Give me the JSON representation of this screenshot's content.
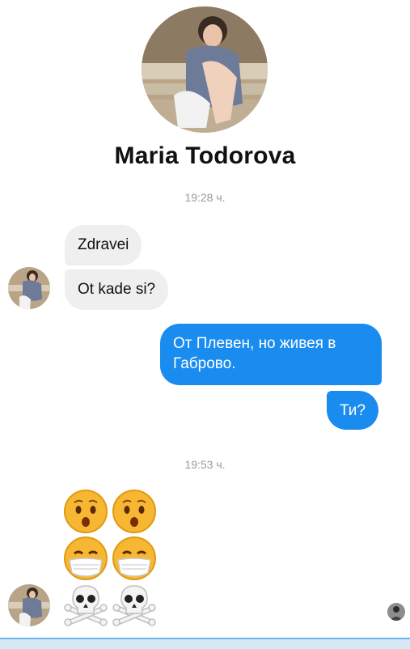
{
  "contact": {
    "name": "Maria Todorova"
  },
  "timestamps": [
    "19:28 ч.",
    "19:53 ч."
  ],
  "messages": [
    {
      "side": "incoming",
      "text": "Zdravei"
    },
    {
      "side": "incoming",
      "text": "Ot kade si?"
    },
    {
      "side": "outgoing",
      "text": "От Плевен, но живея в Габрово."
    },
    {
      "side": "outgoing",
      "text": "Ти?"
    }
  ],
  "emoji_message": {
    "icons": [
      "hushed-face-icon",
      "hushed-face-icon",
      "mask-face-icon",
      "mask-face-icon",
      "skull-crossbones-icon",
      "skull-crossbones-icon"
    ]
  },
  "colors": {
    "outgoing_bubble": "#1a8cf0",
    "incoming_bubble": "#efefef",
    "timestamp": "#9a9a9a"
  }
}
